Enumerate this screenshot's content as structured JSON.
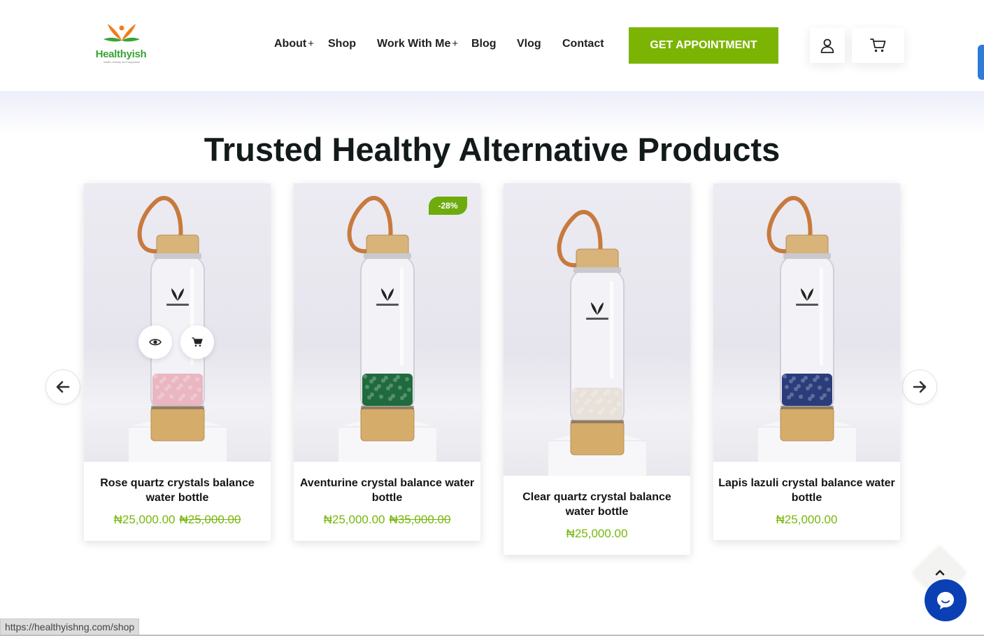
{
  "brand": {
    "name": "Healthyish",
    "tagline": "health, beauty and happiness"
  },
  "nav": {
    "items": [
      {
        "label": "About",
        "has_submenu": true
      },
      {
        "label": "Shop",
        "has_submenu": false
      },
      {
        "label": "Work With Me",
        "has_submenu": true
      },
      {
        "label": "Blog",
        "has_submenu": false
      },
      {
        "label": "Vlog",
        "has_submenu": false
      },
      {
        "label": "Contact",
        "has_submenu": false
      }
    ],
    "submenu_indicator": "+",
    "cta_label": "GET APPOINTMENT",
    "account_icon": "user-icon",
    "cart_icon": "cart-icon"
  },
  "section": {
    "heading": "Trusted Healthy Alternative Products"
  },
  "products": [
    {
      "title": "Rose quartz crystals balance water bottle",
      "price": "₦25,000.00",
      "old_price": "₦25,000.00",
      "badge": "",
      "crystal_color": "#e9b6c2"
    },
    {
      "title": "Aventurine crystal balance water bottle",
      "price": "₦25,000.00",
      "old_price": "₦35,000.00",
      "badge": "-28%",
      "crystal_color": "#1f6b3e"
    },
    {
      "title": "Clear quartz crystal balance water bottle",
      "price": "₦25,000.00",
      "old_price": "",
      "badge": "",
      "crystal_color": "#e7e1da"
    },
    {
      "title": "Lapis lazuli crystal balance water bottle",
      "price": "₦25,000.00",
      "old_price": "",
      "badge": "",
      "crystal_color": "#2a3c7a"
    }
  ],
  "colors": {
    "accent": "#7cb404",
    "price": "#77b80b",
    "badge": "#6eab0d",
    "chat": "#0b3fb4",
    "side_tab": "#2f7bd8"
  },
  "status_bar": {
    "url": "https://healthyishng.com/shop"
  }
}
